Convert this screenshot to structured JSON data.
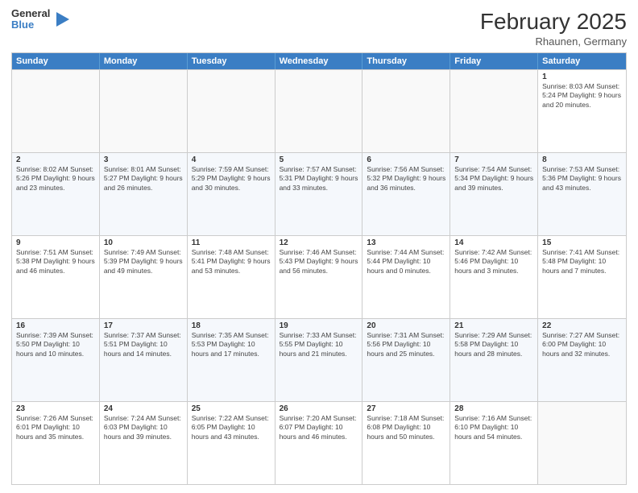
{
  "header": {
    "logo_line1": "General",
    "logo_line2": "Blue",
    "main_title": "February 2025",
    "subtitle": "Rhaunen, Germany"
  },
  "days_of_week": [
    "Sunday",
    "Monday",
    "Tuesday",
    "Wednesday",
    "Thursday",
    "Friday",
    "Saturday"
  ],
  "weeks": [
    [
      {
        "day": "",
        "info": ""
      },
      {
        "day": "",
        "info": ""
      },
      {
        "day": "",
        "info": ""
      },
      {
        "day": "",
        "info": ""
      },
      {
        "day": "",
        "info": ""
      },
      {
        "day": "",
        "info": ""
      },
      {
        "day": "1",
        "info": "Sunrise: 8:03 AM\nSunset: 5:24 PM\nDaylight: 9 hours\nand 20 minutes."
      }
    ],
    [
      {
        "day": "2",
        "info": "Sunrise: 8:02 AM\nSunset: 5:26 PM\nDaylight: 9 hours\nand 23 minutes."
      },
      {
        "day": "3",
        "info": "Sunrise: 8:01 AM\nSunset: 5:27 PM\nDaylight: 9 hours\nand 26 minutes."
      },
      {
        "day": "4",
        "info": "Sunrise: 7:59 AM\nSunset: 5:29 PM\nDaylight: 9 hours\nand 30 minutes."
      },
      {
        "day": "5",
        "info": "Sunrise: 7:57 AM\nSunset: 5:31 PM\nDaylight: 9 hours\nand 33 minutes."
      },
      {
        "day": "6",
        "info": "Sunrise: 7:56 AM\nSunset: 5:32 PM\nDaylight: 9 hours\nand 36 minutes."
      },
      {
        "day": "7",
        "info": "Sunrise: 7:54 AM\nSunset: 5:34 PM\nDaylight: 9 hours\nand 39 minutes."
      },
      {
        "day": "8",
        "info": "Sunrise: 7:53 AM\nSunset: 5:36 PM\nDaylight: 9 hours\nand 43 minutes."
      }
    ],
    [
      {
        "day": "9",
        "info": "Sunrise: 7:51 AM\nSunset: 5:38 PM\nDaylight: 9 hours\nand 46 minutes."
      },
      {
        "day": "10",
        "info": "Sunrise: 7:49 AM\nSunset: 5:39 PM\nDaylight: 9 hours\nand 49 minutes."
      },
      {
        "day": "11",
        "info": "Sunrise: 7:48 AM\nSunset: 5:41 PM\nDaylight: 9 hours\nand 53 minutes."
      },
      {
        "day": "12",
        "info": "Sunrise: 7:46 AM\nSunset: 5:43 PM\nDaylight: 9 hours\nand 56 minutes."
      },
      {
        "day": "13",
        "info": "Sunrise: 7:44 AM\nSunset: 5:44 PM\nDaylight: 10 hours\nand 0 minutes."
      },
      {
        "day": "14",
        "info": "Sunrise: 7:42 AM\nSunset: 5:46 PM\nDaylight: 10 hours\nand 3 minutes."
      },
      {
        "day": "15",
        "info": "Sunrise: 7:41 AM\nSunset: 5:48 PM\nDaylight: 10 hours\nand 7 minutes."
      }
    ],
    [
      {
        "day": "16",
        "info": "Sunrise: 7:39 AM\nSunset: 5:50 PM\nDaylight: 10 hours\nand 10 minutes."
      },
      {
        "day": "17",
        "info": "Sunrise: 7:37 AM\nSunset: 5:51 PM\nDaylight: 10 hours\nand 14 minutes."
      },
      {
        "day": "18",
        "info": "Sunrise: 7:35 AM\nSunset: 5:53 PM\nDaylight: 10 hours\nand 17 minutes."
      },
      {
        "day": "19",
        "info": "Sunrise: 7:33 AM\nSunset: 5:55 PM\nDaylight: 10 hours\nand 21 minutes."
      },
      {
        "day": "20",
        "info": "Sunrise: 7:31 AM\nSunset: 5:56 PM\nDaylight: 10 hours\nand 25 minutes."
      },
      {
        "day": "21",
        "info": "Sunrise: 7:29 AM\nSunset: 5:58 PM\nDaylight: 10 hours\nand 28 minutes."
      },
      {
        "day": "22",
        "info": "Sunrise: 7:27 AM\nSunset: 6:00 PM\nDaylight: 10 hours\nand 32 minutes."
      }
    ],
    [
      {
        "day": "23",
        "info": "Sunrise: 7:26 AM\nSunset: 6:01 PM\nDaylight: 10 hours\nand 35 minutes."
      },
      {
        "day": "24",
        "info": "Sunrise: 7:24 AM\nSunset: 6:03 PM\nDaylight: 10 hours\nand 39 minutes."
      },
      {
        "day": "25",
        "info": "Sunrise: 7:22 AM\nSunset: 6:05 PM\nDaylight: 10 hours\nand 43 minutes."
      },
      {
        "day": "26",
        "info": "Sunrise: 7:20 AM\nSunset: 6:07 PM\nDaylight: 10 hours\nand 46 minutes."
      },
      {
        "day": "27",
        "info": "Sunrise: 7:18 AM\nSunset: 6:08 PM\nDaylight: 10 hours\nand 50 minutes."
      },
      {
        "day": "28",
        "info": "Sunrise: 7:16 AM\nSunset: 6:10 PM\nDaylight: 10 hours\nand 54 minutes."
      },
      {
        "day": "",
        "info": ""
      }
    ]
  ]
}
